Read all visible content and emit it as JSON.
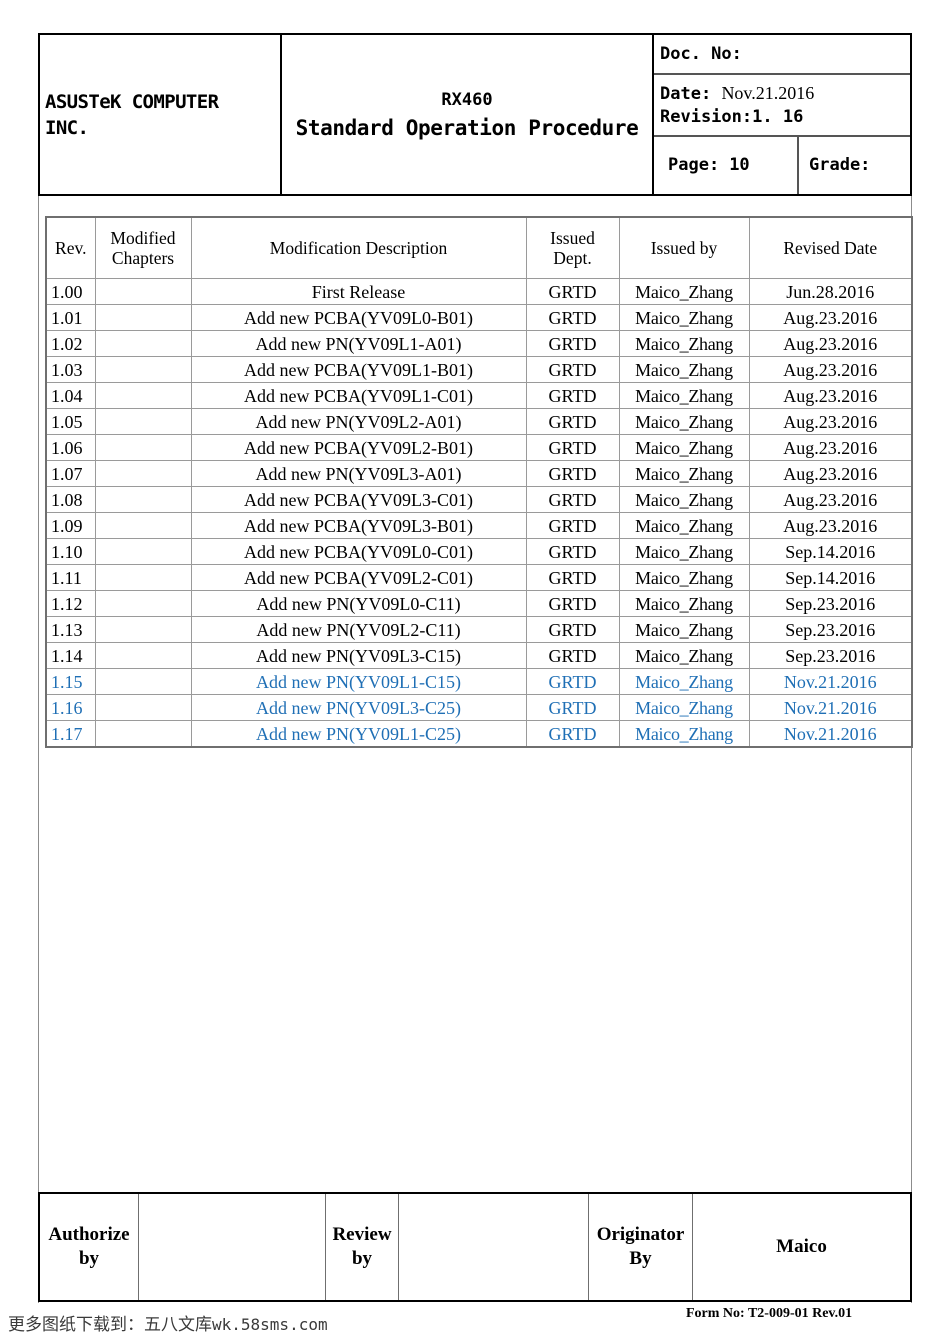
{
  "header": {
    "company_line1": "ASUSTeK COMPUTER",
    "company_line2": "INC.",
    "title_model": "RX460",
    "title_main": "Standard Operation Procedure",
    "doc_no_label": "Doc. No:",
    "doc_no_value": "",
    "date_label": "Date:",
    "date_value": "Nov.21.2016",
    "revision_label": "Revision:",
    "revision_value": "1. 16",
    "page_label": "Page:",
    "page_value": "10",
    "grade_label": "Grade:",
    "grade_value": ""
  },
  "revision_table": {
    "columns": [
      "Rev.",
      "Modified Chapters",
      "Modification Description",
      "Issued Dept.",
      "Issued by",
      "Revised Date"
    ],
    "column_lines": {
      "modified_chapters": [
        "Modified",
        "Chapters"
      ],
      "issued_dept": [
        "Issued",
        "Dept."
      ]
    },
    "rows": [
      {
        "rev": "1.00",
        "chapters": "",
        "description": "First Release",
        "dept": "GRTD",
        "issued_by": "Maico_Zhang",
        "date": "Jun.28.2016",
        "highlight": false
      },
      {
        "rev": "1.01",
        "chapters": "",
        "description": "Add new PCBA(YV09L0-B01)",
        "dept": "GRTD",
        "issued_by": "Maico_Zhang",
        "date": "Aug.23.2016",
        "highlight": false
      },
      {
        "rev": "1.02",
        "chapters": "",
        "description": "Add new PN(YV09L1-A01)",
        "dept": "GRTD",
        "issued_by": "Maico_Zhang",
        "date": "Aug.23.2016",
        "highlight": false
      },
      {
        "rev": "1.03",
        "chapters": "",
        "description": "Add new PCBA(YV09L1-B01)",
        "dept": "GRTD",
        "issued_by": "Maico_Zhang",
        "date": "Aug.23.2016",
        "highlight": false
      },
      {
        "rev": "1.04",
        "chapters": "",
        "description": "Add new PCBA(YV09L1-C01)",
        "dept": "GRTD",
        "issued_by": "Maico_Zhang",
        "date": "Aug.23.2016",
        "highlight": false
      },
      {
        "rev": "1.05",
        "chapters": "",
        "description": "Add new PN(YV09L2-A01)",
        "dept": "GRTD",
        "issued_by": "Maico_Zhang",
        "date": "Aug.23.2016",
        "highlight": false
      },
      {
        "rev": "1.06",
        "chapters": "",
        "description": "Add new PCBA(YV09L2-B01)",
        "dept": "GRTD",
        "issued_by": "Maico_Zhang",
        "date": "Aug.23.2016",
        "highlight": false
      },
      {
        "rev": "1.07",
        "chapters": "",
        "description": "Add new PN(YV09L3-A01)",
        "dept": "GRTD",
        "issued_by": "Maico_Zhang",
        "date": "Aug.23.2016",
        "highlight": false
      },
      {
        "rev": "1.08",
        "chapters": "",
        "description": "Add new PCBA(YV09L3-C01)",
        "dept": "GRTD",
        "issued_by": "Maico_Zhang",
        "date": "Aug.23.2016",
        "highlight": false
      },
      {
        "rev": "1.09",
        "chapters": "",
        "description": "Add new PCBA(YV09L3-B01)",
        "dept": "GRTD",
        "issued_by": "Maico_Zhang",
        "date": "Aug.23.2016",
        "highlight": false
      },
      {
        "rev": "1.10",
        "chapters": "",
        "description": "Add new PCBA(YV09L0-C01)",
        "dept": "GRTD",
        "issued_by": "Maico_Zhang",
        "date": "Sep.14.2016",
        "highlight": false
      },
      {
        "rev": "1.11",
        "chapters": "",
        "description": "Add new PCBA(YV09L2-C01)",
        "dept": "GRTD",
        "issued_by": "Maico_Zhang",
        "date": "Sep.14.2016",
        "highlight": false
      },
      {
        "rev": "1.12",
        "chapters": "",
        "description": "Add new PN(YV09L0-C11)",
        "dept": "GRTD",
        "issued_by": "Maico_Zhang",
        "date": "Sep.23.2016",
        "highlight": false
      },
      {
        "rev": "1.13",
        "chapters": "",
        "description": "Add new PN(YV09L2-C11)",
        "dept": "GRTD",
        "issued_by": "Maico_Zhang",
        "date": "Sep.23.2016",
        "highlight": false
      },
      {
        "rev": "1.14",
        "chapters": "",
        "description": "Add new PN(YV09L3-C15)",
        "dept": "GRTD",
        "issued_by": "Maico_Zhang",
        "date": "Sep.23.2016",
        "highlight": false
      },
      {
        "rev": "1.15",
        "chapters": "",
        "description": "Add new PN(YV09L1-C15)",
        "dept": "GRTD",
        "issued_by": "Maico_Zhang",
        "date": "Nov.21.2016",
        "highlight": true
      },
      {
        "rev": "1.16",
        "chapters": "",
        "description": "Add new PN(YV09L3-C25)",
        "dept": "GRTD",
        "issued_by": "Maico_Zhang",
        "date": "Nov.21.2016",
        "highlight": true
      },
      {
        "rev": "1.17",
        "chapters": "",
        "description": "Add new PN(YV09L1-C25)",
        "dept": "GRTD",
        "issued_by": "Maico_Zhang",
        "date": "Nov.21.2016",
        "highlight": true
      }
    ],
    "highlight_color": "#1f6fb5"
  },
  "signature_block": {
    "authorize_label_line1": "Authorize",
    "authorize_label_line2": "by",
    "authorize_value": "",
    "review_label_line1": "Review",
    "review_label_line2": "by",
    "review_value": "",
    "originator_label_line1": "Originator",
    "originator_label_line2": "By",
    "originator_value": "Maico"
  },
  "footer": {
    "watermark_cn": "更多图纸下载到：五八文库",
    "watermark_url": "wk.58sms.com",
    "form_no": "Form No: T2-009-01 Rev.01"
  }
}
